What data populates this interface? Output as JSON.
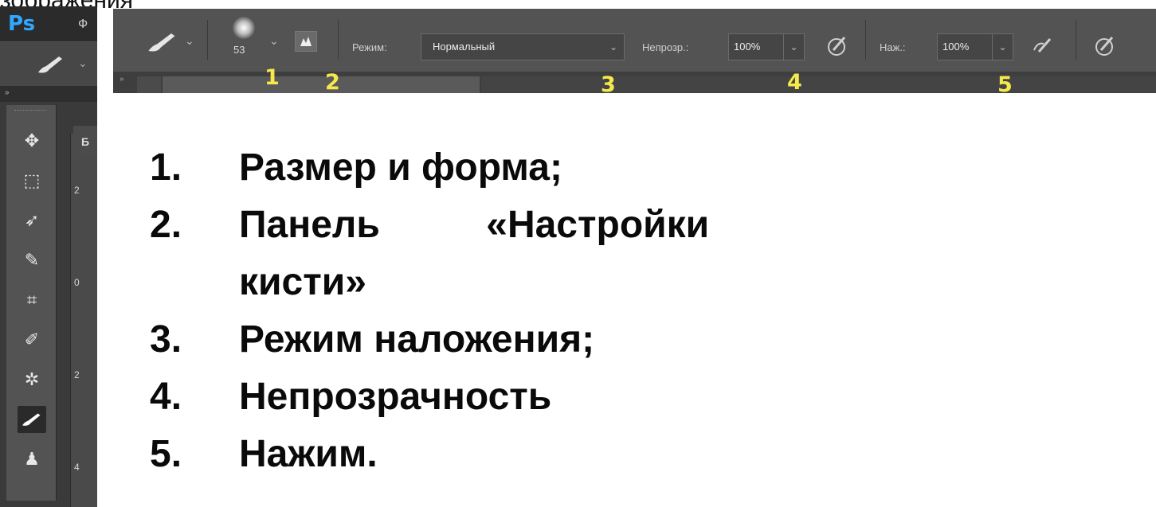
{
  "top_cut_text": "зображения",
  "photoshop": {
    "logo": "Ps",
    "menu_first_letter": "Ф",
    "doc_tab_letter": "Б",
    "ruler_marks": [
      "2",
      "0",
      "2",
      "4"
    ],
    "left_toolbar_icons": [
      "move-icon",
      "marquee-icon",
      "lasso-icon",
      "quick-select-icon",
      "crop-icon",
      "eyedropper-icon",
      "healing-icon",
      "brush-icon",
      "stamp-icon"
    ]
  },
  "options_bar": {
    "brush_size": "53",
    "mode_label": "Режим:",
    "mode_value": "Нормальный",
    "opacity_label": "Непрозр.:",
    "opacity_value": "100%",
    "flow_label": "Наж.:",
    "flow_value": "100%",
    "annotations": [
      "1",
      "2",
      "3",
      "4",
      "5"
    ]
  },
  "list": {
    "items": [
      {
        "num": "1.",
        "text": "Размер и форма;"
      },
      {
        "num": "2.",
        "text": "Панель          «Настройки"
      },
      {
        "num": "",
        "text": "кисти»"
      },
      {
        "num": "3.",
        "text": "Режим наложения;"
      },
      {
        "num": "4.",
        "text": "Непрозрачность"
      },
      {
        "num": "5.",
        "text": "Нажим."
      }
    ]
  },
  "colors": {
    "annotation": "#f5e94b",
    "ps_blue": "#31a8ff",
    "panel_dark": "#535353"
  }
}
